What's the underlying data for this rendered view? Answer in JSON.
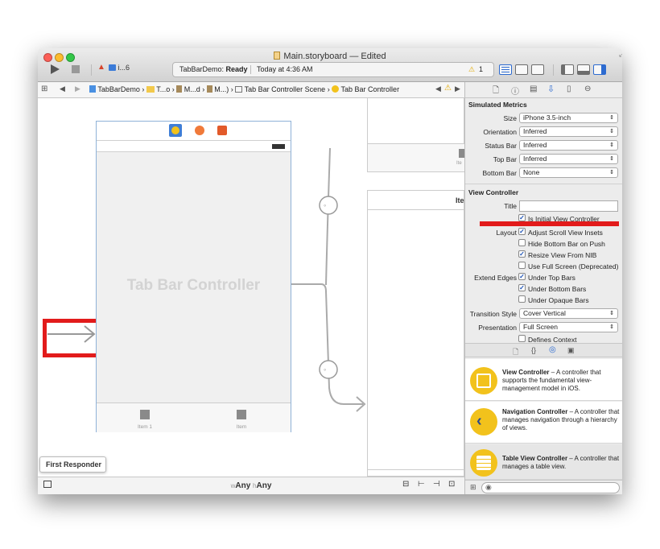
{
  "window": {
    "title": "Main.storyboard — Edited"
  },
  "toolbar": {
    "scheme": "i...6",
    "status_app": "TabBarDemo:",
    "status_state": "Ready",
    "status_time": "Today at 4:36 AM",
    "warning_count": "1"
  },
  "jumpbar": {
    "crumbs": [
      "TabBarDemo",
      "T...o",
      "M...d",
      "M...)",
      "Tab Bar Controller Scene",
      "Tab Bar Controller"
    ]
  },
  "canvas": {
    "tbc_title": "Tab Bar Controller",
    "item1": "Item 1",
    "item2": "Item",
    "partial_text": "Ite",
    "partial_text2": "Ite",
    "first_responder": "First Responder",
    "size_class_w": "w",
    "size_class_any1": "Any",
    "size_class_h": "h",
    "size_class_any2": "Any"
  },
  "inspector": {
    "simulated_metrics": "Simulated Metrics",
    "size_label": "Size",
    "size_value": "iPhone 3.5-inch",
    "orientation_label": "Orientation",
    "orientation_value": "Inferred",
    "statusbar_label": "Status Bar",
    "statusbar_value": "Inferred",
    "topbar_label": "Top Bar",
    "topbar_value": "Inferred",
    "bottombar_label": "Bottom Bar",
    "bottombar_value": "None",
    "view_controller": "View Controller",
    "title_label": "Title",
    "is_initial": "Is Initial View Controller",
    "layout_label": "Layout",
    "adjust_scroll": "Adjust Scroll View Insets",
    "hide_bottom": "Hide Bottom Bar on Push",
    "resize_nib": "Resize View From NIB",
    "full_screen": "Use Full Screen (Deprecated)",
    "extend_label": "Extend Edges",
    "under_top": "Under Top Bars",
    "under_bottom": "Under Bottom Bars",
    "under_opaque": "Under Opaque Bars",
    "transition_label": "Transition Style",
    "transition_value": "Cover Vertical",
    "presentation_label": "Presentation",
    "presentation_value": "Full Screen",
    "defines_context": "Defines Context"
  },
  "library": [
    {
      "title": "View Controller",
      "desc": " – A controller that supports the fundamental view-management model in iOS."
    },
    {
      "title": "Navigation Controller",
      "desc": " – A controller that manages navigation through a hierarchy of views."
    },
    {
      "title": "Table View Controller",
      "desc": " – A controller that manages a table view."
    }
  ]
}
